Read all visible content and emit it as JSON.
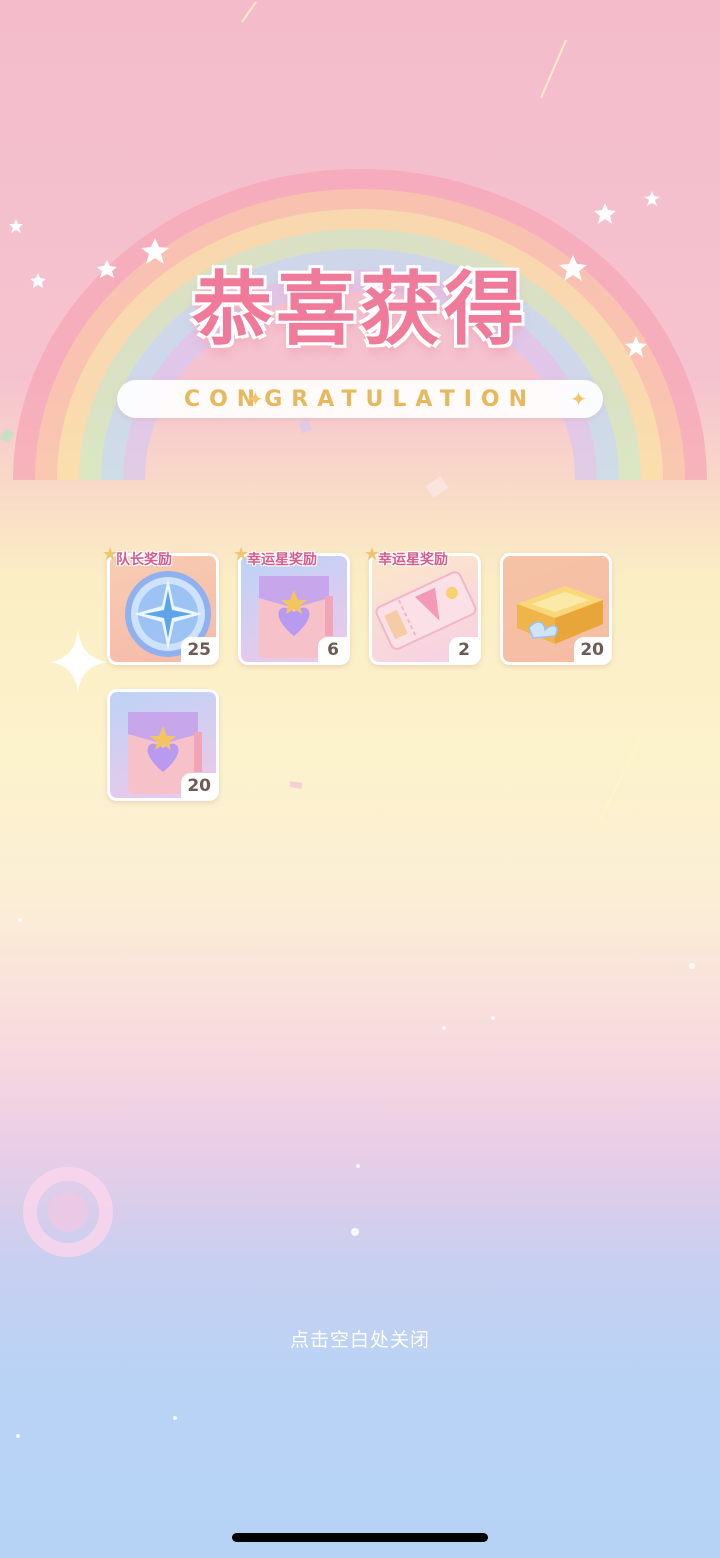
{
  "header": {
    "title": "恭喜获得",
    "subtitle": "CONGRATULATION"
  },
  "rewards": [
    {
      "tag": "队长奖励",
      "quantity": "25",
      "icon": "compass-star-medal-icon"
    },
    {
      "tag": "幸运星奖励",
      "quantity": "6",
      "icon": "purple-heart-gift-bag-icon"
    },
    {
      "tag": "幸运星奖励",
      "quantity": "2",
      "icon": "pink-ticket-icon"
    },
    {
      "tag": "",
      "quantity": "20",
      "icon": "golden-gift-box-icon"
    },
    {
      "tag": "",
      "quantity": "20",
      "icon": "purple-heart-gift-bag-icon"
    }
  ],
  "footer": {
    "close_hint": "点击空白处关闭"
  },
  "colors": {
    "title_pink": "#f07a9a",
    "banner_gold": "#e8b95c",
    "tag_pink": "#d45d8c"
  }
}
